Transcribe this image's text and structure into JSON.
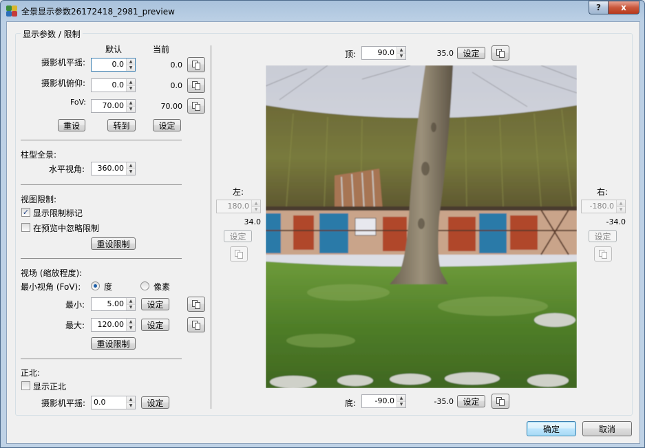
{
  "window": {
    "title": "全景显示参数26172418_2981_preview",
    "help_label": "?",
    "close_label": "x"
  },
  "group_title": "显示参数 / 限制",
  "camera": {
    "col_default": "默认",
    "col_current": "当前",
    "pan": {
      "label": "摄影机平摇:",
      "value": "0.0",
      "current": "0.0"
    },
    "tilt": {
      "label": "摄影机俯仰:",
      "value": "0.0",
      "current": "0.0"
    },
    "fov": {
      "label": "FoV:",
      "value": "70.00",
      "current": "70.00"
    },
    "reset_label": "重设",
    "goto_label": "转到",
    "set_label": "设定"
  },
  "cylinder": {
    "title": "柱型全景:",
    "hfov_label": "水平视角:",
    "hfov_value": "360.00"
  },
  "view_limits": {
    "title": "视图限制:",
    "show_markers_label": "显示限制标记",
    "show_markers_checked": true,
    "ignore_preview_label": "在预览中忽略限制",
    "ignore_preview_checked": false,
    "reset_label": "重设限制"
  },
  "zoom": {
    "title": "视场 (缩放程度):",
    "min_fov_label": "最小视角 (FoV):",
    "unit_degree": "度",
    "unit_pixel": "像素",
    "selected_unit": "度",
    "min_label": "最小:",
    "min_value": "5.00",
    "max_label": "最大:",
    "max_value": "120.00",
    "set_label": "设定",
    "reset_label": "重设限制"
  },
  "north": {
    "title": "正北:",
    "show_label": "显示正北",
    "show_checked": false,
    "pan_label": "摄影机平摇:",
    "pan_value": "0.0",
    "set_label": "设定"
  },
  "limits": {
    "top": {
      "label": "顶:",
      "value": "90.0",
      "current": "35.0",
      "set_label": "设定"
    },
    "bottom": {
      "label": "底:",
      "value": "-90.0",
      "current": "-35.0",
      "set_label": "设定"
    },
    "left": {
      "label": "左:",
      "value": "180.0",
      "current": "34.0",
      "set_label": "设定"
    },
    "right": {
      "label": "右:",
      "value": "-180.0",
      "current": "-34.0",
      "set_label": "设定"
    }
  },
  "footer": {
    "ok_label": "确定",
    "cancel_label": "取消"
  },
  "colors": {
    "title_bar": "#bcd0e5",
    "close_button": "#c9583c",
    "dialog_bg": "#f0f0f0",
    "default_button_border": "#3c7fb1"
  }
}
